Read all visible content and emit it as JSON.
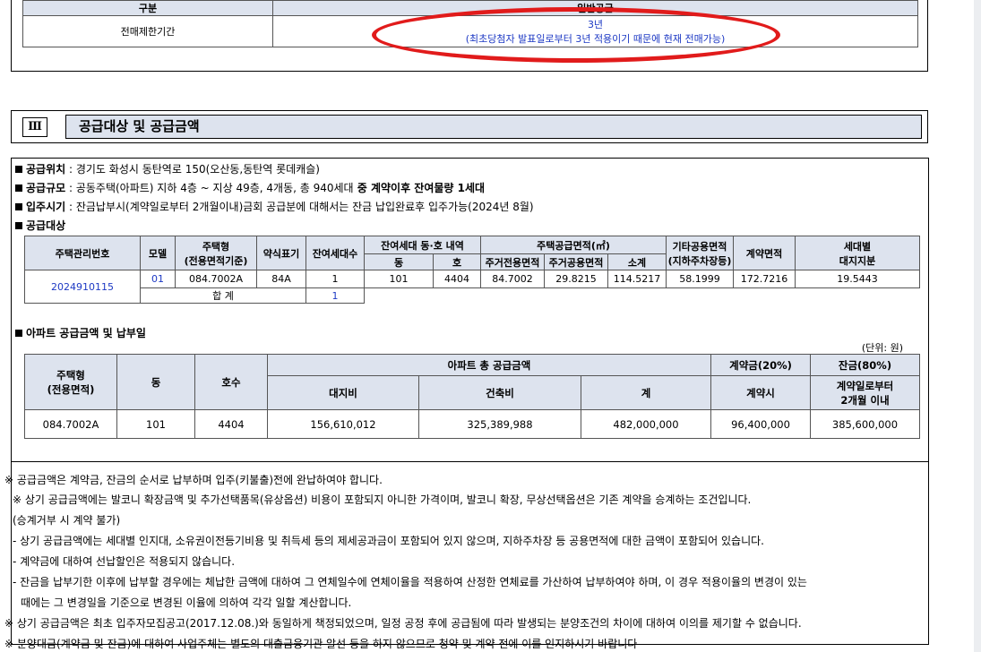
{
  "resale": {
    "header_left": "구분",
    "header_right": "일반공급",
    "row_label": "전매제한기간",
    "value_line1": "3년",
    "value_line2": "(최초당첨자 발표일로부터 3년 적용이기 때문에 현재 전매가능)",
    "highlight_color": "#e11b1b"
  },
  "section": {
    "number": "Ⅲ",
    "title": "공급대상 및 공급금액"
  },
  "info": {
    "location_label": "공급위치",
    "location_text": " : 경기도 화성시 동탄역로 150(오산동,동탄역 롯데캐슬)",
    "scale_label": "공급규모",
    "scale_text": " : 공동주택(아파트) 지하 4층 ~ 지상 49층, 4개동, 총 940세대",
    "scale_bold": " 중 계약이후 잔여물량 1세대",
    "movein_label": "입주시기",
    "movein_text": " : 잔금납부시(계약일로부터 2개월이내)금회 공급분에 대해서는 잔금 납입완료후 입주가능(2024년 8월)",
    "target_label": "공급대상"
  },
  "table1": {
    "headers": {
      "mgmt_no": "주택관리번호",
      "model": "모델",
      "type": "주택형",
      "type_sub": "(전용면적기준)",
      "abbr": "약식표기",
      "remain": "잔여세대수",
      "remain_detail": "잔여세대 동·호 내역",
      "dong": "동",
      "ho": "호",
      "supply_area": "주택공급면적(㎡)",
      "exclusive": "주거전용면적",
      "common": "주거공용면적",
      "subtotal": "소계",
      "other": "기타공용면적",
      "other_sub": "(지하주차장등)",
      "contract_area": "계약면적",
      "land": "세대별",
      "land_sub": "대지지분"
    },
    "row": {
      "mgmt_no": "2024910115",
      "model": "01",
      "type": "084.7002A",
      "abbr": "84A",
      "remain": "1",
      "dong": "101",
      "ho": "4404",
      "exclusive": "84.7002",
      "common": "29.8215",
      "subtotal": "114.5217",
      "other": "58.1999",
      "contract_area": "172.7216",
      "land": "19.5443"
    },
    "total_label": "합 계",
    "total_value": "1"
  },
  "price": {
    "title": "아파트 공급금액 및 납부일",
    "unit": "(단위:    원)",
    "headers": {
      "type": "주택형",
      "type_sub": "(전용면적)",
      "dong": "동",
      "ho": "호수",
      "total_supply": "아파트 총 공급금액",
      "land": "대지비",
      "building": "건축비",
      "sum": "계",
      "deposit": "계약금(20%)",
      "deposit_when": "계약시",
      "balance": "잔금(80%)",
      "balance_when1": "계약일로부터",
      "balance_when2": "2개월 이내"
    },
    "row": {
      "type": "084.7002A",
      "dong": "101",
      "ho": "4404",
      "land": "156,610,012",
      "building": "325,389,988",
      "sum": "482,000,000",
      "deposit": "96,400,000",
      "balance": "385,600,000"
    }
  },
  "notes": [
    "※ 공급금액은 계약금, 잔금의 순서로 납부하며 입주(키불출)전에 완납하여야 합니다.",
    "※ 상기 공급금액에는 발코니 확장금액 및 추가선택품목(유상옵션) 비용이 포함되지 아니한 가격이며, 발코니 확장, 무상선택옵션은 기존 계약을 승계하는 조건입니다.",
    "(승계거부 시 계약 불가)",
    "- 상기 공급금액에는 세대별 인지대, 소유권이전등기비용 및 취득세 등의 제세공과금이 포함되어 있지 않으며, 지하주차장 등 공용면적에 대한 금액이 포함되어 있습니다.",
    "- 계약금에 대하여 선납할인은 적용되지 않습니다.",
    "- 잔금을 납부기한 이후에 납부할 경우에는 체납한 금액에 대하여 그 연체일수에 연체이율을 적용하여 산정한 연체료를 가산하여 납부하여야 하며, 이 경우 적용이율의 변경이 있는",
    "때에는 그 변경일을 기준으로 변경된 이율에 의하여 각각 일할 계산합니다.",
    "※ 상기 공급금액은 최초 입주자모집공고(2017.12.08.)와 동일하게 책정되었으며, 일정 공정 후에 공급됨에 따라 발생되는 분양조건의 차이에 대하여 이의를 제기할 수 없습니다.",
    "※ 분양대금(계약금 및 잔금)에 대하여 사업주체는 별도의 대출금융기관 알선 등을 하지 않으므로 청약 및 계약 전에 이를 인지하시기 바랍니다"
  ]
}
